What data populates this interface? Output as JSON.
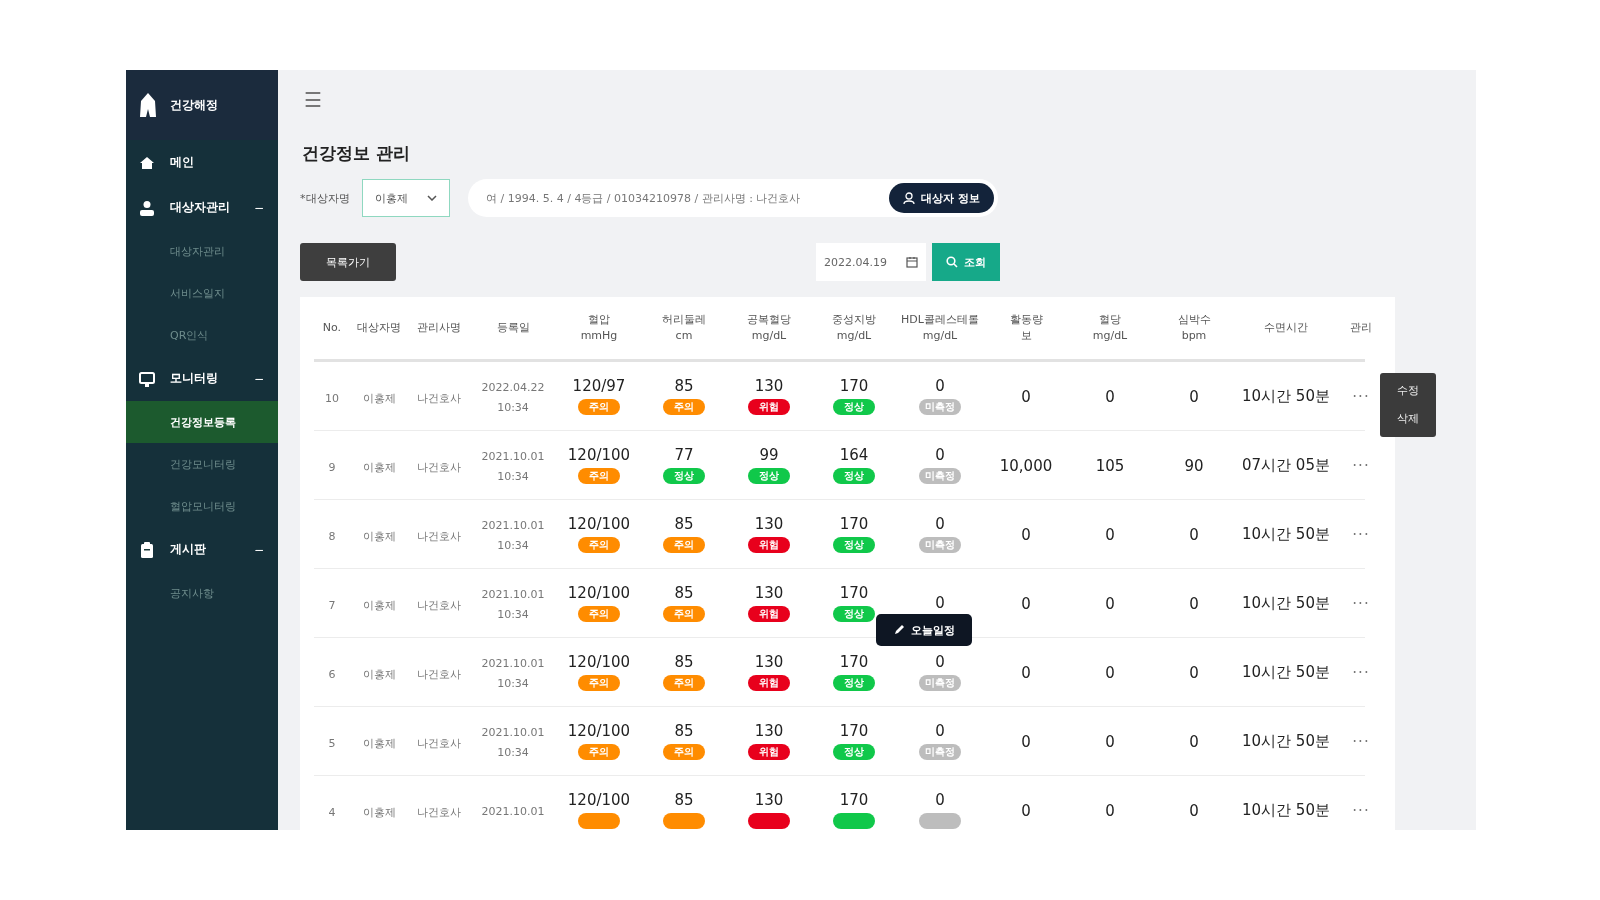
{
  "sidebar": {
    "logo": "건강해정",
    "items": [
      {
        "label": "메인"
      },
      {
        "label": "대상자관리",
        "toggle": "−",
        "children": [
          {
            "label": "대상자관리",
            "selected": false
          },
          {
            "label": "서비스일지",
            "selected": false
          },
          {
            "label": "QR인식",
            "selected": false
          }
        ]
      },
      {
        "label": "모니터링",
        "toggle": "−",
        "children": [
          {
            "label": "건강정보등록",
            "selected": true
          },
          {
            "label": "건강모니터링",
            "selected": false
          },
          {
            "label": "혈압모니터링",
            "selected": false
          }
        ]
      },
      {
        "label": "게시판",
        "toggle": "−",
        "children": [
          {
            "label": "공지사항",
            "selected": false
          }
        ]
      }
    ]
  },
  "menu_button": "☰",
  "page_title": "건강정보 관리",
  "filter": {
    "label": "*대상자명",
    "select_value": "이홍제",
    "info": "여 / 1994. 5. 4 / 4등급 / 01034210978 / 관리사명 : 나건호사",
    "info_button": "대상자 정보"
  },
  "back_button": "목록가기",
  "date": "2022.04.19",
  "search_button": "조회",
  "table": {
    "columns": [
      {
        "label": "No."
      },
      {
        "label": "대상자명"
      },
      {
        "label": "관리사명"
      },
      {
        "label": "등록일"
      },
      {
        "label": "혈압",
        "unit": "mmHg"
      },
      {
        "label": "허리둘레",
        "unit": "cm"
      },
      {
        "label": "공복혈당",
        "unit": "mg/dL"
      },
      {
        "label": "중성지방",
        "unit": "mg/dL"
      },
      {
        "label": "HDL콜레스테롤",
        "unit": "mg/dL"
      },
      {
        "label": "활동량",
        "unit": "보"
      },
      {
        "label": "혈당",
        "unit": "mg/dL"
      },
      {
        "label": "심박수",
        "unit": "bpm"
      },
      {
        "label": "수면시간"
      },
      {
        "label": "관리"
      }
    ],
    "rows": [
      {
        "no": "10",
        "name": "이홍제",
        "manager": "나건호사",
        "date": "2022.04.22",
        "time": "10:34",
        "metrics": [
          {
            "value": "120/97",
            "badge": "주의",
            "color": "#ff8c00"
          },
          {
            "value": "85",
            "badge": "주의",
            "color": "#ff8c00"
          },
          {
            "value": "130",
            "badge": "위험",
            "color": "#e8001c"
          },
          {
            "value": "170",
            "badge": "정상",
            "color": "#10c84a"
          },
          {
            "value": "0",
            "badge": "미측정",
            "color": "#bdbdbd"
          }
        ],
        "activity": "0",
        "sugar": "0",
        "heart_rate": "0",
        "sleep": "10시간 50분",
        "more": "···",
        "menu": [
          "수정",
          "삭제"
        ]
      },
      {
        "no": "9",
        "name": "이홍제",
        "manager": "나건호사",
        "date": "2021.10.01",
        "time": "10:34",
        "metrics": [
          {
            "value": "120/100",
            "badge": "주의",
            "color": "#ff8c00"
          },
          {
            "value": "77",
            "badge": "정상",
            "color": "#10c84a"
          },
          {
            "value": "99",
            "badge": "정상",
            "color": "#10c84a"
          },
          {
            "value": "164",
            "badge": "정상",
            "color": "#10c84a"
          },
          {
            "value": "0",
            "badge": "미측정",
            "color": "#bdbdbd"
          }
        ],
        "activity": "10,000",
        "sugar": "105",
        "heart_rate": "90",
        "sleep": "07시간 05분",
        "more": "···"
      },
      {
        "no": "8",
        "name": "이홍제",
        "manager": "나건호사",
        "date": "2021.10.01",
        "time": "10:34",
        "metrics": [
          {
            "value": "120/100",
            "badge": "주의",
            "color": "#ff8c00"
          },
          {
            "value": "85",
            "badge": "주의",
            "color": "#ff8c00"
          },
          {
            "value": "130",
            "badge": "위험",
            "color": "#e8001c"
          },
          {
            "value": "170",
            "badge": "정상",
            "color": "#10c84a"
          },
          {
            "value": "0",
            "badge": "미측정",
            "color": "#bdbdbd"
          }
        ],
        "activity": "0",
        "sugar": "0",
        "heart_rate": "0",
        "sleep": "10시간 50분",
        "more": "···"
      },
      {
        "no": "7",
        "name": "이홍제",
        "manager": "나건호사",
        "date": "2021.10.01",
        "time": "10:34",
        "metrics": [
          {
            "value": "120/100",
            "badge": "주의",
            "color": "#ff8c00"
          },
          {
            "value": "85",
            "badge": "주의",
            "color": "#ff8c00"
          },
          {
            "value": "130",
            "badge": "위험",
            "color": "#e8001c"
          },
          {
            "value": "170",
            "badge": "정상",
            "color": "#10c84a"
          },
          {
            "value": "0",
            "tooltip": "오늘일정"
          }
        ],
        "activity": "0",
        "sugar": "0",
        "heart_rate": "0",
        "sleep": "10시간 50분",
        "more": "···"
      },
      {
        "no": "6",
        "name": "이홍제",
        "manager": "나건호사",
        "date": "2021.10.01",
        "time": "10:34",
        "metrics": [
          {
            "value": "120/100",
            "badge": "주의",
            "color": "#ff8c00"
          },
          {
            "value": "85",
            "badge": "주의",
            "color": "#ff8c00"
          },
          {
            "value": "130",
            "badge": "위험",
            "color": "#e8001c"
          },
          {
            "value": "170",
            "badge": "정상",
            "color": "#10c84a"
          },
          {
            "value": "0",
            "badge": "미측정",
            "color": "#bdbdbd"
          }
        ],
        "activity": "0",
        "sugar": "0",
        "heart_rate": "0",
        "sleep": "10시간 50분",
        "more": "···"
      },
      {
        "no": "5",
        "name": "이홍제",
        "manager": "나건호사",
        "date": "2021.10.01",
        "time": "10:34",
        "metrics": [
          {
            "value": "120/100",
            "badge": "주의",
            "color": "#ff8c00"
          },
          {
            "value": "85",
            "badge": "주의",
            "color": "#ff8c00"
          },
          {
            "value": "130",
            "badge": "위험",
            "color": "#e8001c"
          },
          {
            "value": "170",
            "badge": "정상",
            "color": "#10c84a"
          },
          {
            "value": "0",
            "badge": "미측정",
            "color": "#bdbdbd"
          }
        ],
        "activity": "0",
        "sugar": "0",
        "heart_rate": "0",
        "sleep": "10시간 50분",
        "more": "···"
      },
      {
        "no": "4",
        "name": "이홍제",
        "manager": "나건호사",
        "date": "2021.10.01",
        "metrics": [
          {
            "value": "120/100",
            "color": "#ff8c00"
          },
          {
            "value": "85",
            "color": "#ff8c00"
          },
          {
            "value": "130",
            "color": "#e8001c"
          },
          {
            "value": "170",
            "color": "#10c84a"
          },
          {
            "value": "0",
            "color": "#bdbdbd"
          }
        ],
        "activity": "0",
        "sugar": "0",
        "heart_rate": "0",
        "sleep": "10시간 50분",
        "more": "···"
      }
    ]
  }
}
